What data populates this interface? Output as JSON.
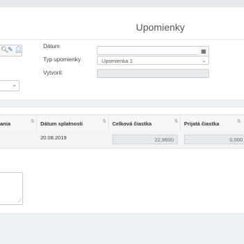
{
  "header": {
    "title": "Upomienky"
  },
  "form": {
    "date_label": "Dátum",
    "date_value": "",
    "type_label": "Typ upomienky",
    "type_value": "Upomienka 1",
    "created_label": "Vytvoril:",
    "created_value": ""
  },
  "icons": {
    "search": "search-icon",
    "edit": "pencil-icon",
    "user": "user-icon",
    "calendar": "calendar-icon",
    "chevron": "chevron-down-icon",
    "sort": "sort-icon"
  },
  "grid": {
    "columns": [
      "ania",
      "Dátum splatnosti",
      "Celková čiastka",
      "Prijatá čiastka"
    ],
    "rows": [
      {
        "due_date": "20.08.2019",
        "total": "22,9600",
        "received": "0,000"
      }
    ]
  }
}
